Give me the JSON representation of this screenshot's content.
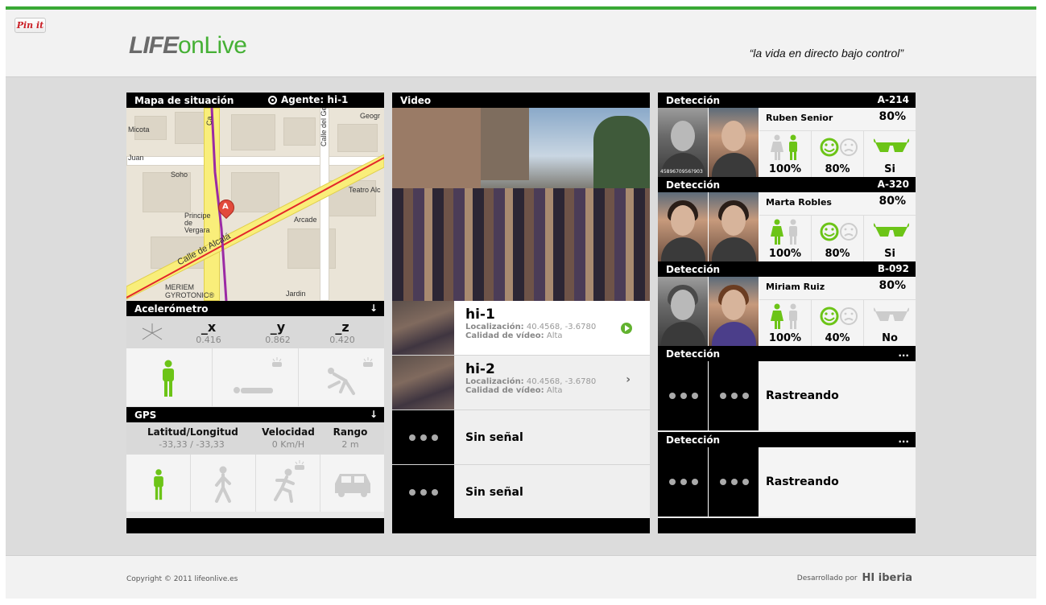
{
  "header": {
    "pinit_label": "Pin it",
    "logo_bold": "LIFE",
    "logo_light": "onLive",
    "tagline": "“la vida en directo bajo control”"
  },
  "map_panel": {
    "title": "Mapa de situación",
    "agent_label": "Agente: hi-1",
    "map_labels": [
      "Micota",
      "Juan",
      "Soho",
      "Principe de Vergara",
      "Arcade",
      "Teatro Alc",
      "Geogr",
      "Calle de Alcalá",
      "MERIEM GYROTONIC®",
      "Jardin",
      "Calle del Ge",
      "Ca"
    ],
    "marker_letter": "A"
  },
  "accelerometer": {
    "title": "Acelerómetro",
    "axes": [
      {
        "name": "_x",
        "value": "0.416"
      },
      {
        "name": "_y",
        "value": "0.862"
      },
      {
        "name": "_z",
        "value": "0.420"
      }
    ],
    "states": [
      "standing-icon",
      "lying-icon",
      "falling-icon"
    ]
  },
  "gps": {
    "title": "GPS",
    "cols": [
      {
        "name": "Latitud/Longitud",
        "value": "-33,33 / -33,33"
      },
      {
        "name": "Velocidad",
        "value": "0 Km/H"
      },
      {
        "name": "Rango",
        "value": "2 m"
      }
    ],
    "states": [
      "standing-icon",
      "walking-icon",
      "running-icon",
      "car-icon"
    ]
  },
  "video_panel": {
    "title": "Video",
    "feeds": [
      {
        "name": "hi-1",
        "loc_label": "Localización:",
        "loc_value": "40.4568, -3.6780",
        "q_label": "Calidad de vídeo:",
        "q_value": "Alta"
      },
      {
        "name": "hi-2",
        "loc_label": "Localización:",
        "loc_value": "40.4568, -3.6780",
        "q_label": "Calidad de vídeo:",
        "q_value": "Alta"
      }
    ],
    "no_signal": [
      "Sin señal",
      "Sin señal"
    ]
  },
  "detection_panel": {
    "title": "Detección",
    "entries": [
      {
        "code": "A-214",
        "name": "Ruben Senior",
        "match": "80%",
        "gender": "100%",
        "mood": "80%",
        "glasses": "Si",
        "id_code": "4589670956?903"
      },
      {
        "code": "A-320",
        "name": "Marta Robles",
        "match": "80%",
        "gender": "100%",
        "mood": "80%",
        "glasses": "Si"
      },
      {
        "code": "B-092",
        "name": "Miriam Ruiz",
        "match": "80%",
        "gender": "100%",
        "mood": "40%",
        "glasses": "No"
      }
    ],
    "tracking": [
      {
        "code": "...",
        "label": "Rastreando"
      },
      {
        "code": "...",
        "label": "Rastreando"
      }
    ]
  },
  "footer": {
    "copyright": "Copyright © 2011 lifeonlive.es",
    "developed_by": "Desarrollado por",
    "dev_brand": "HI iberia"
  },
  "colors": {
    "accent": "#39a935",
    "icon_green": "#6cc417",
    "icon_grey": "#cccccc",
    "bar": "#000000"
  }
}
